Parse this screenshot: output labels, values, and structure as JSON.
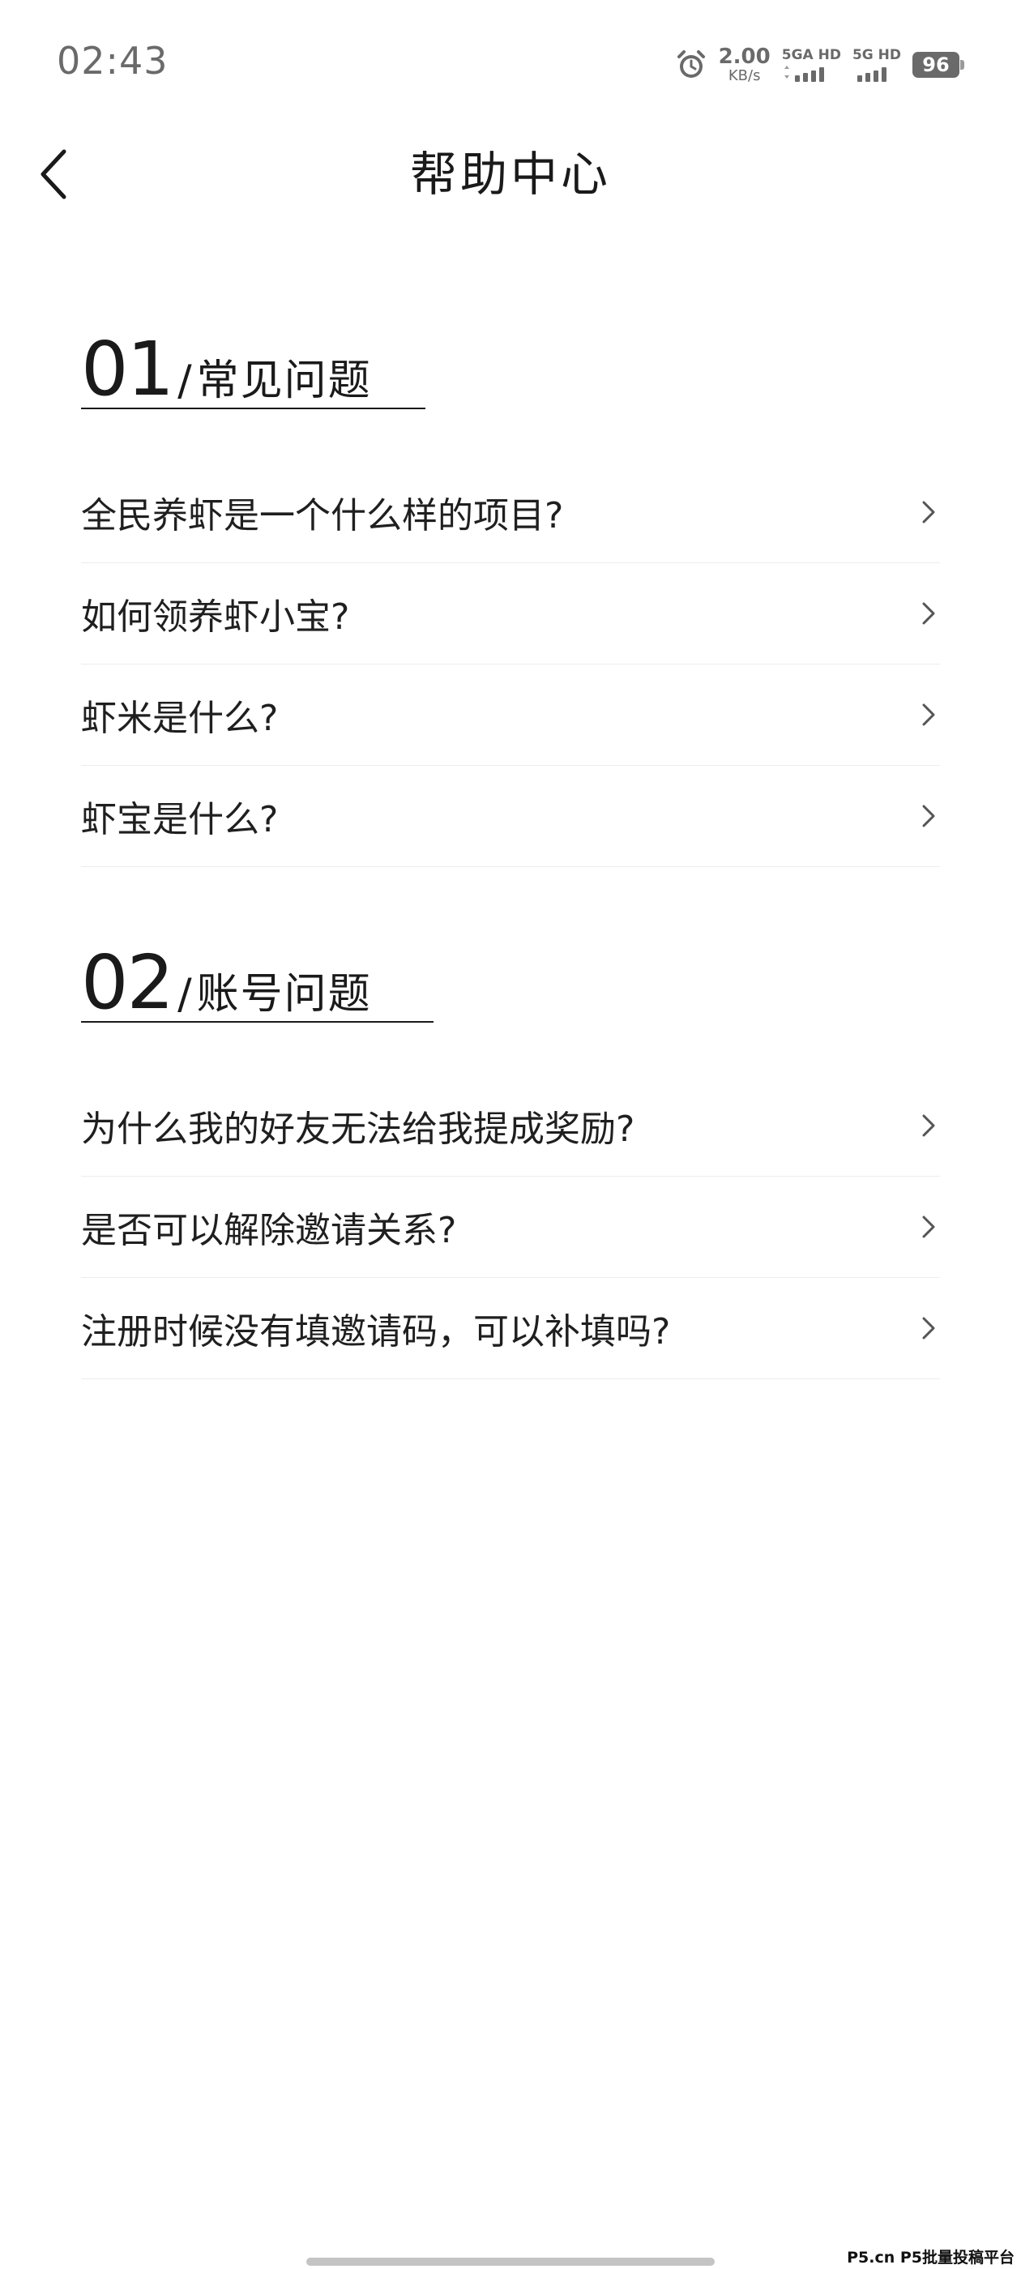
{
  "status_bar": {
    "time": "02:43",
    "net_speed_value": "2.00",
    "net_speed_unit": "KB/s",
    "sim1_label": "5GA HD",
    "sim2_label": "5G HD",
    "battery": "96",
    "icons": [
      "alarm-icon",
      "signal-bars-icon",
      "battery-icon"
    ],
    "text_color": "#6a6a6a"
  },
  "header": {
    "title": "帮助中心",
    "back_icon": "chevron-left-icon"
  },
  "sections": [
    {
      "number": "01",
      "slash": "/",
      "title": "常见问题",
      "items": [
        "全民养虾是一个什么样的项目?",
        "如何领养虾小宝?",
        "虾米是什么?",
        "虾宝是什么?"
      ]
    },
    {
      "number": "02",
      "slash": "/",
      "title": "账号问题",
      "items": [
        "为什么我的好友无法给我提成奖励?",
        "是否可以解除邀请关系?",
        "注册时候没有填邀请码，可以补填吗?"
      ]
    }
  ],
  "watermark": "P5.cn P5批量投稿平台",
  "colors": {
    "background": "#ffffff",
    "text": "#1a1a1a",
    "divider": "#ececec",
    "chevron": "#555555"
  }
}
